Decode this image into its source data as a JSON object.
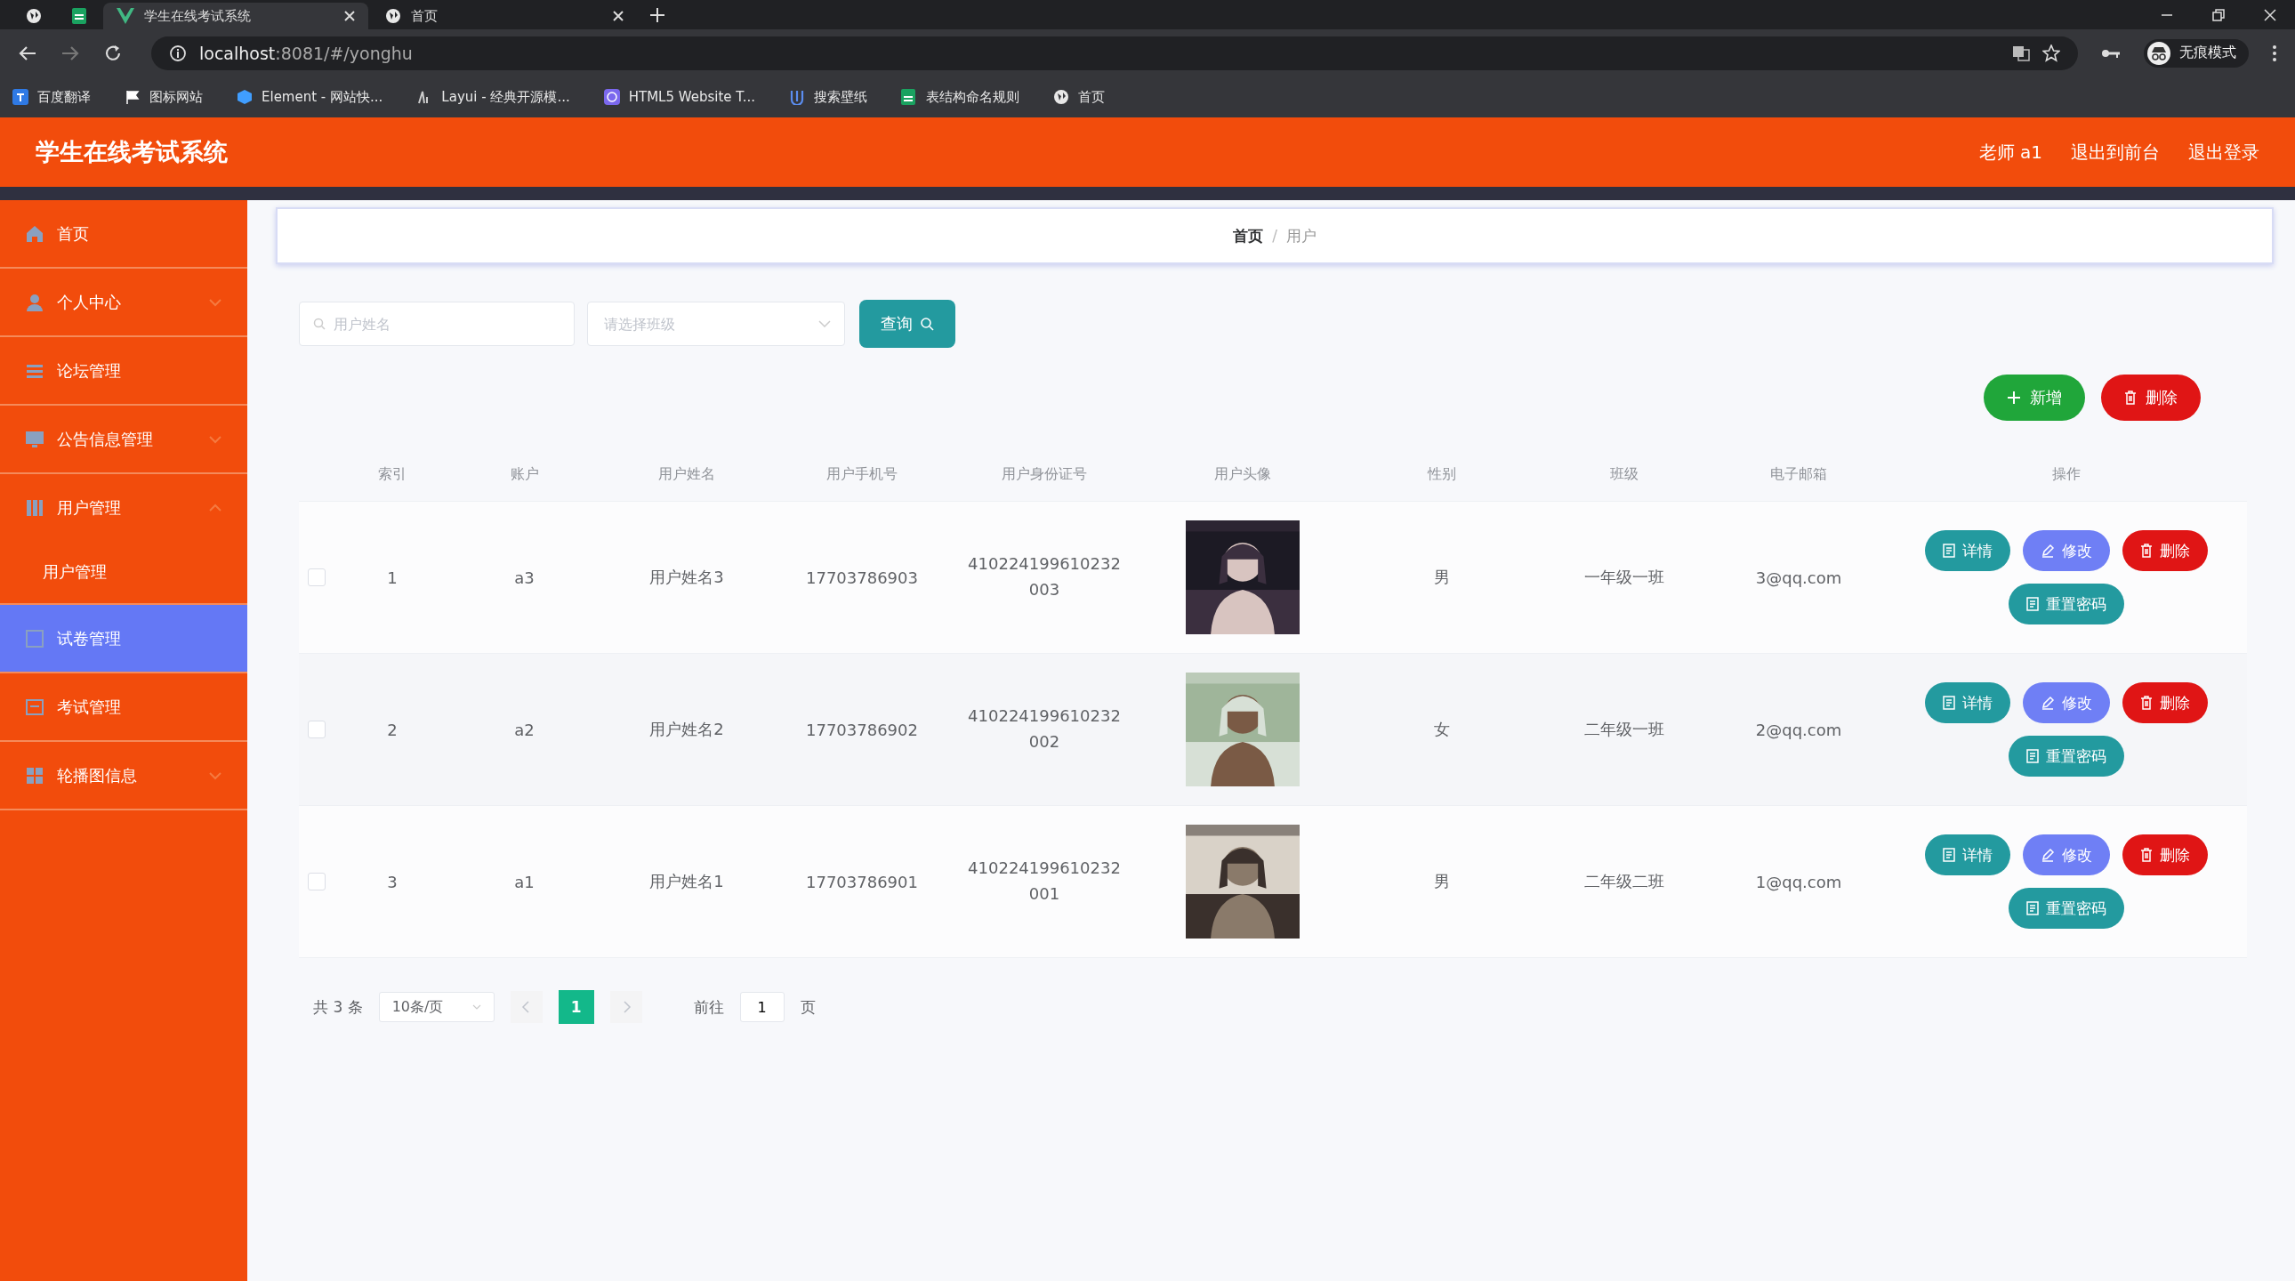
{
  "browser": {
    "tabs": [
      {
        "kind": "pinned-globe",
        "selected": false
      },
      {
        "kind": "pinned-sheet",
        "selected": false
      },
      {
        "kind": "page",
        "title": "学生在线考试系统",
        "selected": true
      },
      {
        "kind": "page",
        "title": "首页",
        "selected": false
      }
    ],
    "address": {
      "host": "localhost",
      "path": ":8081/#/yonghu"
    },
    "bookmarks": [
      "百度翻译",
      "图标网站",
      "Element - 网站快...",
      "Layui - 经典开源模...",
      "HTML5 Website T...",
      "搜索壁纸",
      "表结构命名规则",
      "首页"
    ],
    "profile": "无痕模式"
  },
  "header": {
    "title": "学生在线考试系统",
    "links": [
      "老师 a1",
      "退出到前台",
      "退出登录"
    ]
  },
  "sidebar": {
    "items": [
      {
        "label": "首页",
        "kind": "link",
        "selected": false
      },
      {
        "label": "个人中心",
        "kind": "menu",
        "expanded": false,
        "selected": false
      },
      {
        "label": "论坛管理",
        "kind": "link",
        "selected": false
      },
      {
        "label": "公告信息管理",
        "kind": "menu",
        "expanded": false,
        "selected": false
      },
      {
        "label": "用户管理",
        "kind": "menu",
        "expanded": true,
        "selected": false,
        "children": [
          {
            "label": "用户管理",
            "selected": false
          }
        ]
      },
      {
        "label": "试卷管理",
        "kind": "link",
        "selected": true
      },
      {
        "label": "考试管理",
        "kind": "link",
        "selected": false
      },
      {
        "label": "轮播图信息",
        "kind": "menu",
        "expanded": false,
        "selected": false
      }
    ]
  },
  "breadcrumb": {
    "items": [
      "首页",
      "用户"
    ],
    "separator": "/"
  },
  "search": {
    "name_placeholder": "用户姓名",
    "class_placeholder": "请选择班级",
    "button": "查询"
  },
  "actions": [
    {
      "kind": "add",
      "label": "新增"
    },
    {
      "kind": "delete",
      "label": "删除"
    }
  ],
  "table": {
    "columns": [
      "索引",
      "账户",
      "用户姓名",
      "用户手机号",
      "用户身份证号",
      "用户头像",
      "性别",
      "班级",
      "电子邮箱",
      "操作"
    ],
    "rows": [
      {
        "checked": false,
        "cells": [
          "1",
          "a3",
          "用户姓名3",
          "17703786903",
          "410224199610232003",
          {
            "kind": "picture"
          },
          "男",
          "一年级一班",
          "3@qq.com"
        ],
        "actions": [
          {
            "kind": "detail",
            "label": "详情"
          },
          {
            "kind": "edit",
            "label": "修改"
          },
          {
            "kind": "delete",
            "label": "删除"
          },
          {
            "kind": "reset",
            "label": "重置密码"
          }
        ]
      },
      {
        "checked": false,
        "cells": [
          "2",
          "a2",
          "用户姓名2",
          "17703786902",
          "410224199610232002",
          {
            "kind": "picture"
          },
          "女",
          "二年级一班",
          "2@qq.com"
        ],
        "actions": [
          {
            "kind": "detail",
            "label": "详情"
          },
          {
            "kind": "edit",
            "label": "修改"
          },
          {
            "kind": "delete",
            "label": "删除"
          },
          {
            "kind": "reset",
            "label": "重置密码"
          }
        ]
      },
      {
        "checked": false,
        "cells": [
          "3",
          "a1",
          "用户姓名1",
          "17703786901",
          "410224199610232001",
          {
            "kind": "picture"
          },
          "男",
          "二年级二班",
          "1@qq.com"
        ],
        "actions": [
          {
            "kind": "detail",
            "label": "详情"
          },
          {
            "kind": "edit",
            "label": "修改"
          },
          {
            "kind": "delete",
            "label": "删除"
          },
          {
            "kind": "reset",
            "label": "重置密码"
          }
        ]
      }
    ]
  },
  "pagination": {
    "total": "共 3 条",
    "page_size": "10条/页",
    "pages": [
      {
        "label": "1",
        "selected": true
      }
    ],
    "goto_label": "前往",
    "goto_value": "1",
    "goto_suffix": "页"
  }
}
